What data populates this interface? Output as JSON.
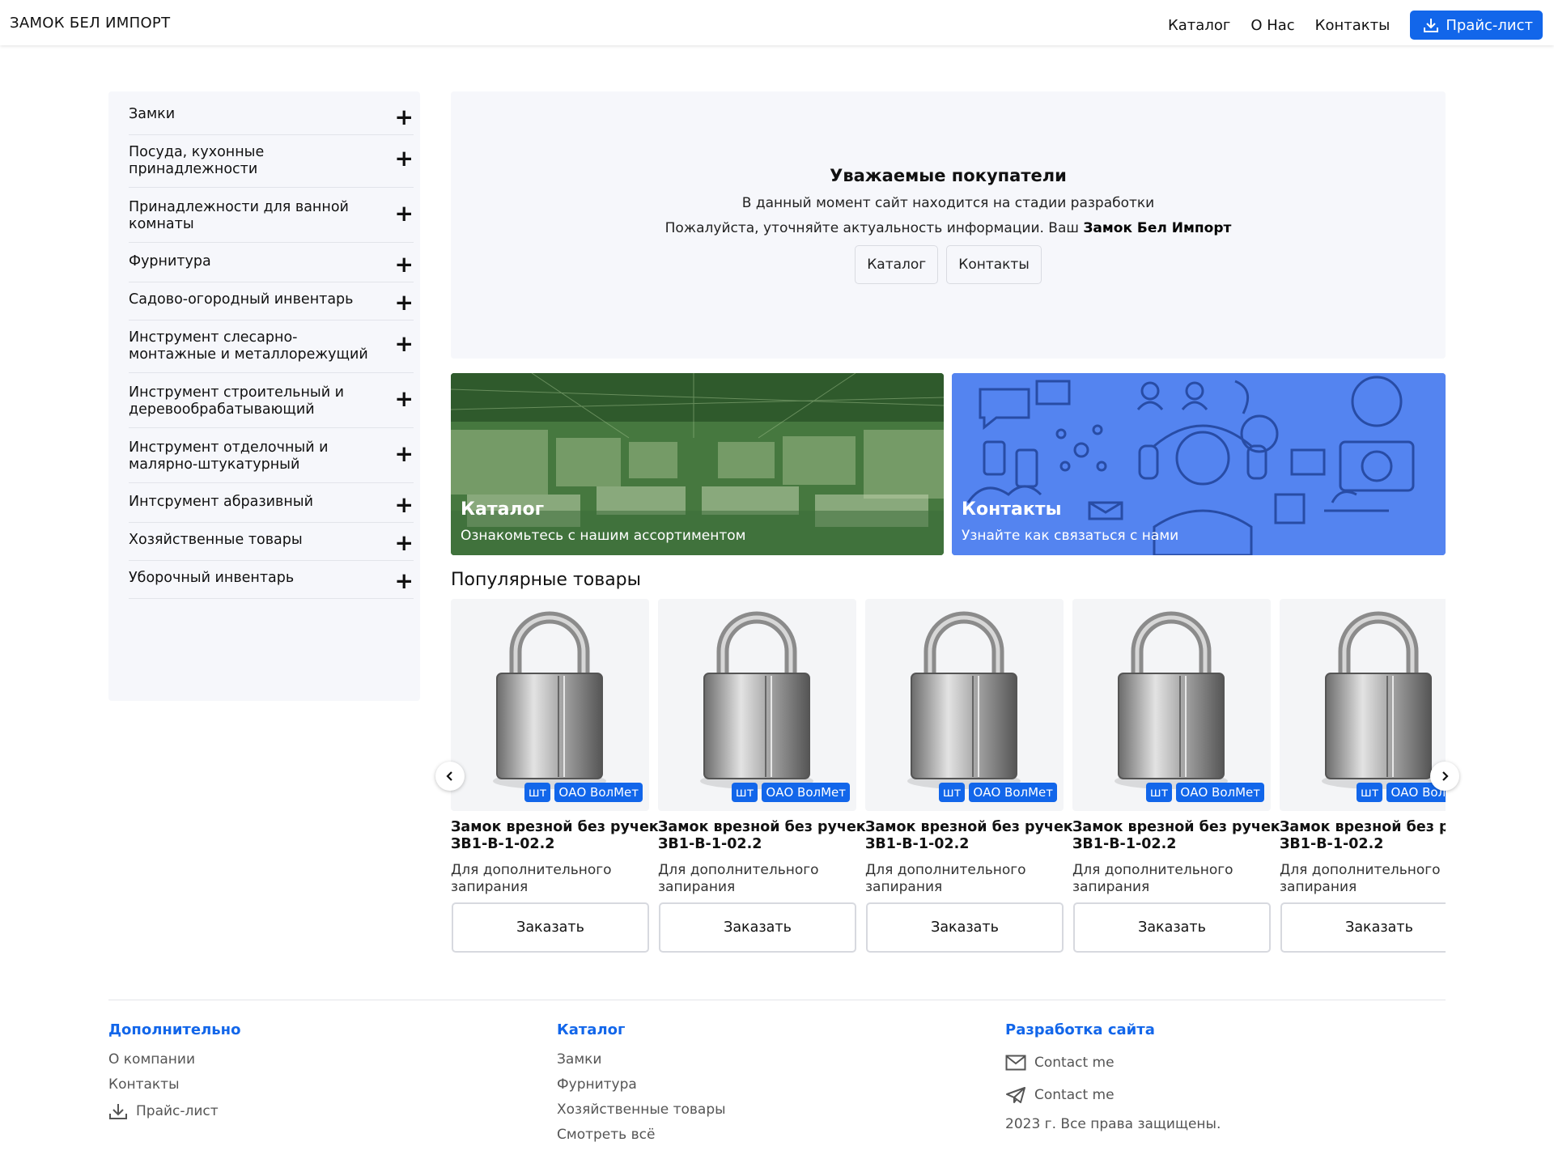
{
  "header": {
    "brand": "ЗАМОК БЕЛ ИМПОРТ",
    "nav": [
      "Каталог",
      "О Нас",
      "Контакты"
    ],
    "price_button": "Прайс-лист",
    "accent_color": "#1266ea"
  },
  "sidebar": {
    "items": [
      {
        "label": "Замки"
      },
      {
        "label": "Посуда, кухонные принадлежности"
      },
      {
        "label": "Принадлежности для ванной комнаты"
      },
      {
        "label": "Фурнитура"
      },
      {
        "label": "Садово-огородный инвентарь"
      },
      {
        "label": "Инструмент слесарно-монтажные и металлорежущий"
      },
      {
        "label": "Инструмент строительный и деревообрабатывающий"
      },
      {
        "label": "Инструмент отделочный и малярно-штукатурный"
      },
      {
        "label": "Интсрумент абразивный"
      },
      {
        "label": "Хозяйственные товары"
      },
      {
        "label": "Уборочный инвентарь"
      }
    ],
    "expand_symbol": "+"
  },
  "notice": {
    "title": "Уважаемые покупатели",
    "line1": "В данный момент сайт находится на стадии разработки",
    "line2_prefix": "Пожалуйста, уточняйте актуальность информации. Ваш ",
    "line2_bold": "Замок Бел Импорт",
    "buttons": [
      "Каталог",
      "Контакты"
    ]
  },
  "banners": {
    "catalog": {
      "title": "Каталог",
      "subtitle": "Ознакомьтесь с нашим ассортиментом"
    },
    "contacts": {
      "title": "Контакты",
      "subtitle": "Узнайте как связаться с нами"
    }
  },
  "popular": {
    "title": "Популярные товары",
    "products": [
      {
        "name_line1": "Замок врезной без ручек",
        "name_line2": "ЗВ1-В-1-02.2",
        "desc": "Для дополнительного запирания",
        "unit": "шт",
        "maker": "ОАО ВолМет",
        "order": "Заказать"
      },
      {
        "name_line1": "Замок врезной без ручек",
        "name_line2": "ЗВ1-В-1-02.2",
        "desc": "Для дополнительного запирания",
        "unit": "шт",
        "maker": "ОАО ВолМет",
        "order": "Заказать"
      },
      {
        "name_line1": "Замок врезной без ручек",
        "name_line2": "ЗВ1-В-1-02.2",
        "desc": "Для дополнительного запирания",
        "unit": "шт",
        "maker": "ОАО ВолМет",
        "order": "Заказать"
      },
      {
        "name_line1": "Замок врезной без ручек",
        "name_line2": "ЗВ1-В-1-02.2",
        "desc": "Для дополнительного запирания",
        "unit": "шт",
        "maker": "ОАО ВолМет",
        "order": "Заказать"
      },
      {
        "name_line1": "Замок врезной без ручек",
        "name_line2": "ЗВ1-В-1-02.2",
        "desc": "Для дополнительного запирания",
        "unit": "шт",
        "maker": "ОАО ВолМет",
        "order": "Заказать"
      }
    ]
  },
  "footer": {
    "extra": {
      "title": "Дополнительно",
      "links": [
        "О компании",
        "Контакты",
        "Прайс-лист"
      ]
    },
    "catalog": {
      "title": "Каталог",
      "links": [
        "Замки",
        "Фурнитура",
        "Хозяйственные товары",
        "Смотреть всё"
      ]
    },
    "dev": {
      "title": "Разработка сайта",
      "email": "Contact me",
      "telegram": "Contact me",
      "copyright": "2023 г. Все права защищены."
    }
  }
}
